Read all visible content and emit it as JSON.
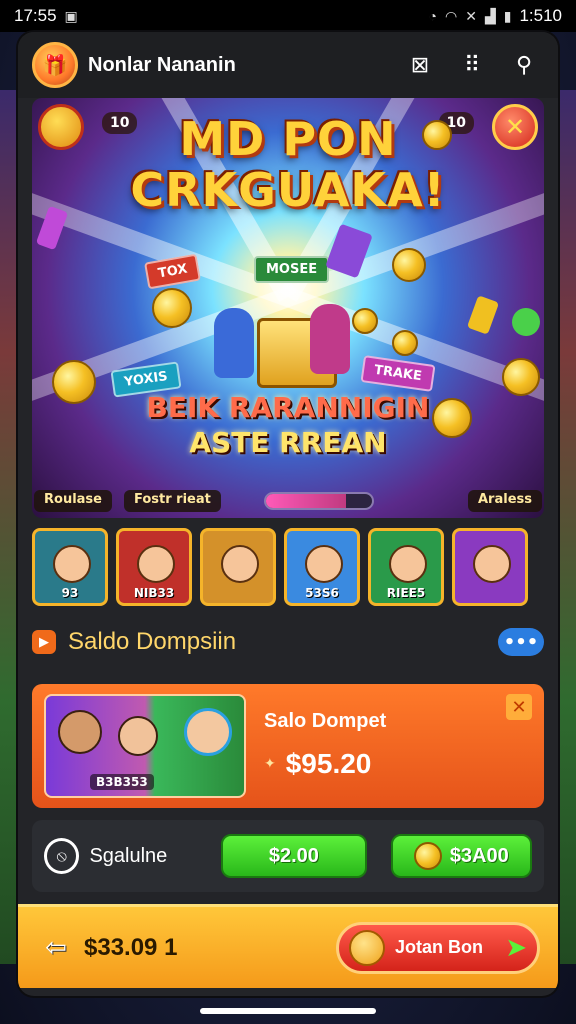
{
  "status_bar": {
    "time": "17:55",
    "time_right": "1:510",
    "icons": [
      "gallery-icon",
      "alarm-icon",
      "wifi-icon",
      "mute-icon",
      "signal-icon",
      "battery-icon"
    ]
  },
  "header": {
    "title": "Nonlar Nananin",
    "icons": [
      "close-box-icon",
      "grid-menu-icon",
      "search-icon"
    ]
  },
  "banner": {
    "headline_line1": "MD PON",
    "headline_line2": "CRKGUAKA!",
    "sub_line1": "BEIK RARANNIGIN",
    "sub_line2": "ASTE RREAN",
    "corner_left": "10",
    "corner_right": "10",
    "tags": [
      "TOX",
      "MOSEE",
      "YOXIS",
      "TRAKE"
    ],
    "bottom_labels": [
      "Roulase",
      "Fostr rieat",
      "Araless"
    ],
    "progress": 0.75
  },
  "thumbnails": [
    {
      "label": "93",
      "bg": "#2a7a8a"
    },
    {
      "label": "NIB33",
      "bg": "#c0302a"
    },
    {
      "label": "",
      "bg": "#d4912a"
    },
    {
      "label": "53S6",
      "bg": "#3a8ae0"
    },
    {
      "label": "RIEE5",
      "bg": "#2a9a4a"
    },
    {
      "label": "",
      "bg": "#8a3ac0"
    }
  ],
  "section": {
    "title": "Saldo Dompsiin",
    "more_label": "•••"
  },
  "wallet": {
    "title": "Salo Dompet",
    "amount": "$95.20",
    "thumb_label": "B3B353",
    "close_label": "✕"
  },
  "actions": {
    "label": "Sgalulne",
    "button_a": "$2.00",
    "button_b": "$3A00"
  },
  "footer": {
    "amount": "$33.09 1",
    "join_label": "Jotan Bon",
    "join_arrow": "➤"
  },
  "colors": {
    "accent_orange": "#f06a1a",
    "gold": "#ffd66a",
    "green": "#29b81a",
    "footer": "#f59a1a"
  }
}
